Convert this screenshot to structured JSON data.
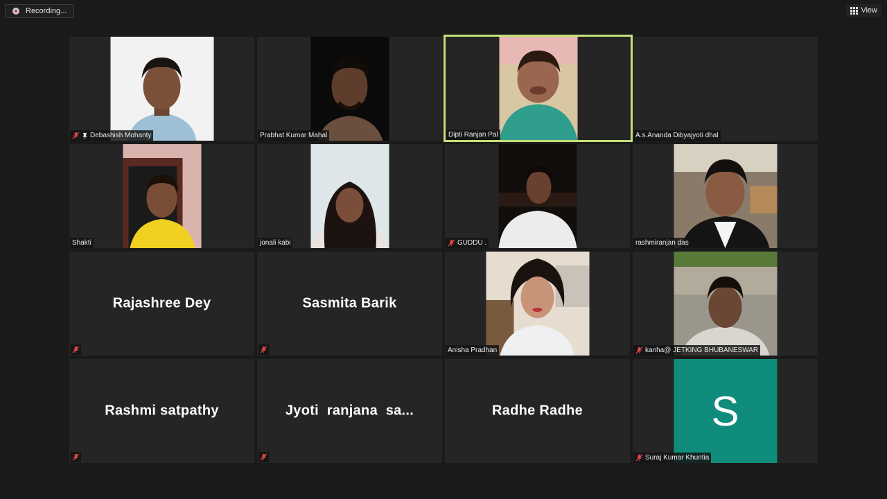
{
  "top_bar": {
    "recording_label": "Recording...",
    "view_label": "View"
  },
  "participants": [
    {
      "name": "Debashish Mohanty",
      "muted": true,
      "pinned": true,
      "video": true
    },
    {
      "name": "Prabhat Kumar Mahal",
      "muted": false,
      "video": true
    },
    {
      "name": "Dipti Ranjan Pal",
      "muted": false,
      "video": true,
      "active_speaker": true
    },
    {
      "name": "A.s.Ananda Dibyajyoti dhal",
      "muted": false,
      "video": false
    },
    {
      "name": "Shakti",
      "muted": false,
      "video": true
    },
    {
      "name": "jonali kabi",
      "muted": false,
      "video": true
    },
    {
      "name": "GUDDU .",
      "muted": true,
      "video": true
    },
    {
      "name": "rashmiranjan das",
      "muted": false,
      "video": true
    },
    {
      "name": "Rajashree Dey",
      "muted": true,
      "video": false
    },
    {
      "name": "Sasmita Barik",
      "muted": true,
      "video": false
    },
    {
      "name": "Anisha Pradhan",
      "muted": false,
      "video": true
    },
    {
      "name": "kanha@ JETKING BHUBANESWAR",
      "muted": true,
      "video": true
    },
    {
      "name": "Rashmi satpathy",
      "muted": true,
      "video": false
    },
    {
      "name": "Jyoti  ranjana  sa...",
      "muted": true,
      "video": false
    },
    {
      "name": "Radhe Radhe",
      "muted": false,
      "video": false
    },
    {
      "name": "Suraj Kumar Khuntia",
      "muted": true,
      "video": false,
      "avatar_letter": "S",
      "avatar_color": "#0f8c7b"
    }
  ],
  "colors": {
    "active_speaker_border": "#c4e07a",
    "muted_icon": "#e04848"
  }
}
